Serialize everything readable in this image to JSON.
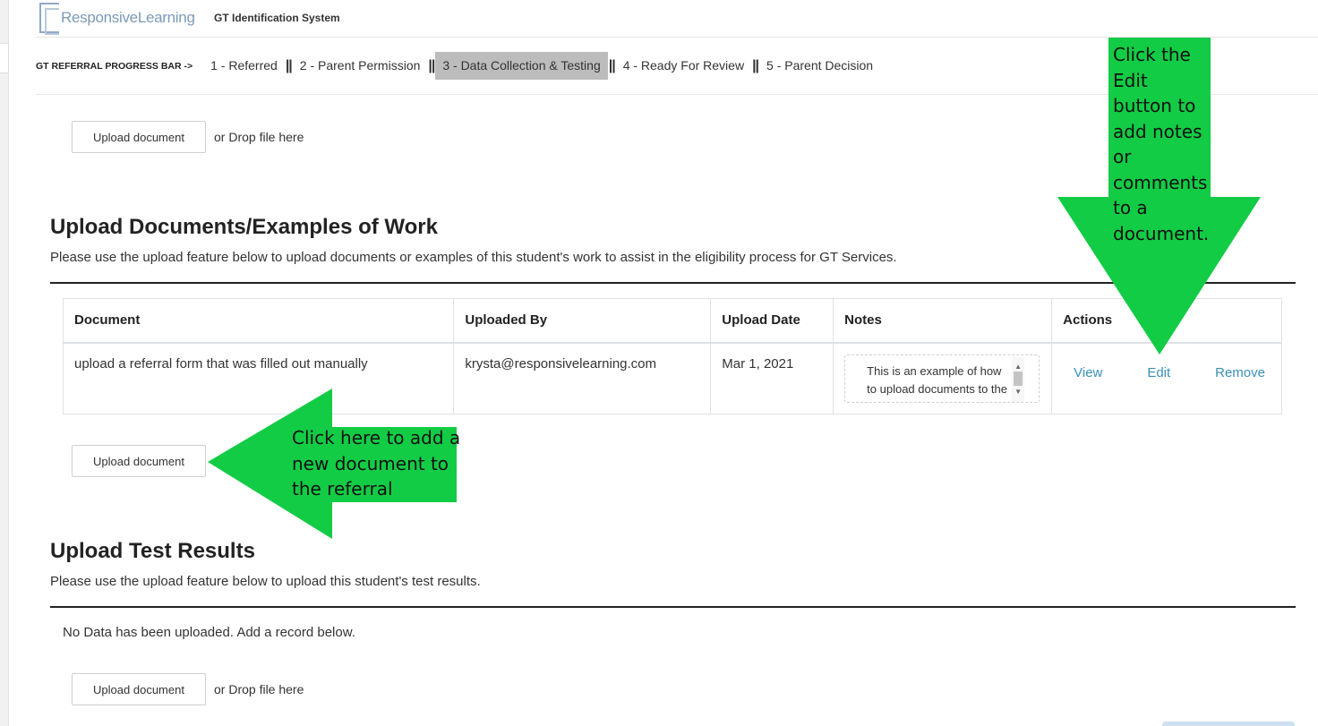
{
  "app": {
    "logo_text": "ResponsiveLearning",
    "system_title": "GT Identification System"
  },
  "progress": {
    "label": "GT REFERRAL PROGRESS BAR ->",
    "steps": [
      {
        "label": "1 - Referred",
        "active": false
      },
      {
        "label": "2 - Parent Permission",
        "active": false
      },
      {
        "label": "3 - Data Collection & Testing",
        "active": true
      },
      {
        "label": "4 - Ready For Review",
        "active": false
      },
      {
        "label": "5 - Parent Decision",
        "active": false
      }
    ],
    "separator": "||"
  },
  "top_upload": {
    "button_label": "Upload document",
    "drop_text": "or Drop file here"
  },
  "documents_section": {
    "title": "Upload Documents/Examples of Work",
    "description": "Please use the upload feature below to upload documents or examples of this student's work to assist in the eligibility process for GT Services.",
    "columns": [
      "Document",
      "Uploaded By",
      "Upload Date",
      "Notes",
      "Actions"
    ],
    "rows": [
      {
        "document": "upload a referral form that was filled out manually",
        "uploaded_by": "krysta@responsivelearning.com",
        "upload_date": "Mar 1, 2021",
        "notes": "This is an example of how to upload documents to the",
        "actions": [
          "View",
          "Edit",
          "Remove"
        ]
      }
    ],
    "upload_button_label": "Upload document"
  },
  "test_results_section": {
    "title": "Upload Test Results",
    "description": "Please use the upload feature below to upload this student's test results.",
    "empty_text": "No Data has been uploaded. Add a record below.",
    "upload_button_label": "Upload document",
    "drop_text": "or Drop file here"
  },
  "annotations": {
    "edit_callout": [
      "Click the",
      "Edit",
      "button to",
      "add notes",
      "or",
      "comments",
      "to a",
      "document."
    ],
    "upload_callout": [
      "Click here to add a",
      "new document to",
      "the referral"
    ],
    "color": "#13cc45"
  },
  "colors": {
    "link": "#3a8fb5",
    "active_step_bg": "#bcbcbc"
  }
}
